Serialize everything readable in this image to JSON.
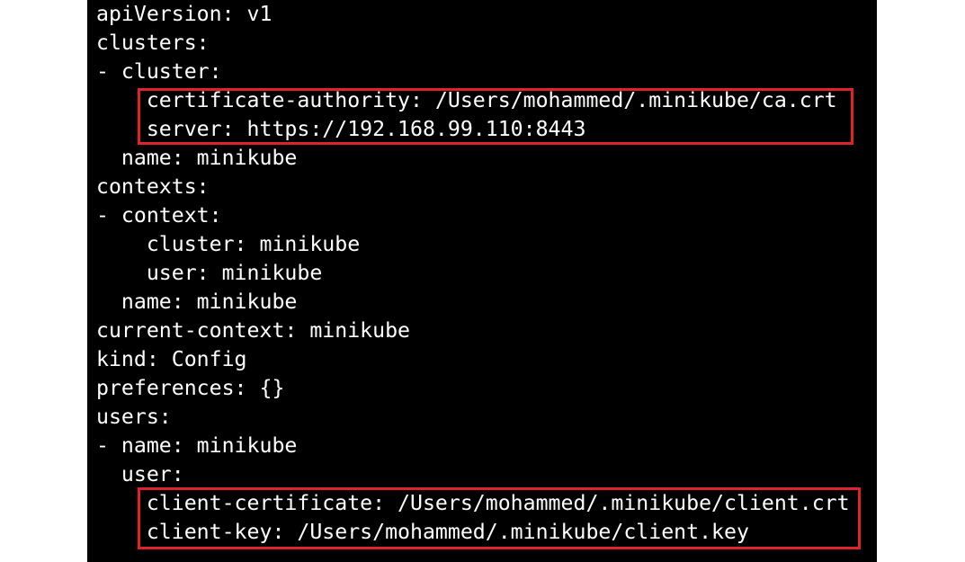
{
  "terminal": {
    "lines": [
      "apiVersion: v1",
      "clusters:",
      "- cluster:",
      "    certificate-authority: /Users/mohammed/.minikube/ca.crt",
      "    server: https://192.168.99.110:8443",
      "  name: minikube",
      "contexts:",
      "- context:",
      "    cluster: minikube",
      "    user: minikube",
      "  name: minikube",
      "current-context: minikube",
      "kind: Config",
      "preferences: {}",
      "users:",
      "- name: minikube",
      "  user:",
      "    client-certificate: /Users/mohammed/.minikube/client.crt",
      "    client-key: /Users/mohammed/.minikube/client.key"
    ]
  },
  "highlights": {
    "color": "#e0232b"
  }
}
